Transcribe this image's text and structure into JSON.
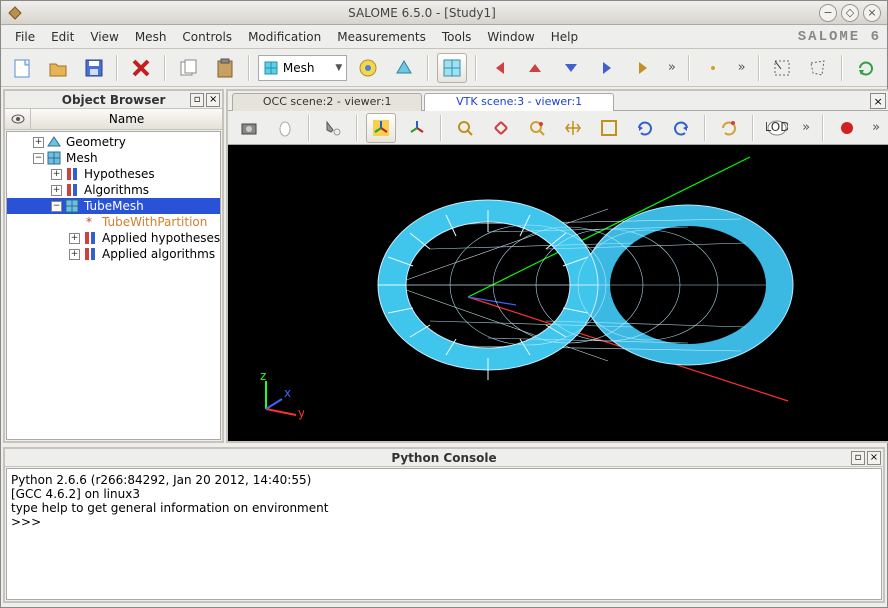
{
  "window": {
    "title": "SALOME 6.5.0 - [Study1]",
    "brand": "SALOME 6"
  },
  "menu": [
    "File",
    "Edit",
    "View",
    "Mesh",
    "Controls",
    "Modification",
    "Measurements",
    "Tools",
    "Window",
    "Help"
  ],
  "context_selector": {
    "label": "Mesh"
  },
  "object_browser": {
    "title": "Object Browser",
    "columns": {
      "name": "Name"
    },
    "tree": [
      {
        "label": "Geometry",
        "level": 1,
        "expander": "+",
        "icon": "geometry-icon"
      },
      {
        "label": "Mesh",
        "level": 1,
        "expander": "−",
        "icon": "mesh-icon"
      },
      {
        "label": "Hypotheses",
        "level": 2,
        "expander": "+",
        "icon": "hyp-icon"
      },
      {
        "label": "Algorithms",
        "level": 2,
        "expander": "+",
        "icon": "hyp-icon"
      },
      {
        "label": "TubeMesh",
        "level": 2,
        "expander": "−",
        "icon": "mesh-node-icon",
        "selected": true
      },
      {
        "label": "TubeWithPartition",
        "level": 3,
        "expander": "",
        "icon": "star-icon",
        "color": "#d08030"
      },
      {
        "label": "Applied hypotheses",
        "level": 3,
        "expander": "+",
        "icon": "hyp-icon"
      },
      {
        "label": "Applied algorithms",
        "level": 3,
        "expander": "+",
        "icon": "hyp-icon"
      }
    ]
  },
  "view": {
    "tabs": [
      {
        "label": "OCC scene:2 - viewer:1",
        "active": false
      },
      {
        "label": "VTK scene:3 - viewer:1",
        "active": true
      }
    ]
  },
  "python_console": {
    "title": "Python Console",
    "lines": [
      "Python 2.6.6 (r266:84292, Jan 20 2012, 14:40:55)",
      "[GCC 4.6.2] on linux3",
      "type help to get general information on environment",
      ">>> "
    ]
  }
}
